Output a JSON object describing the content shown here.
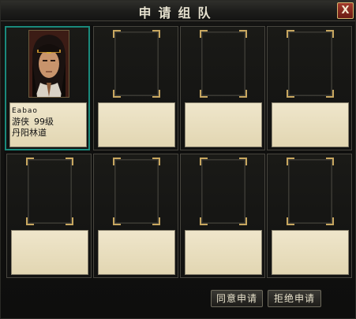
{
  "window": {
    "title": "申请组队",
    "close_label": "X"
  },
  "slots": [
    {
      "occupied": true,
      "name": "Eabao",
      "class": "游侠",
      "level": "99级",
      "location": "丹阳林道"
    },
    {
      "occupied": false
    },
    {
      "occupied": false
    },
    {
      "occupied": false
    },
    {
      "occupied": false
    },
    {
      "occupied": false
    },
    {
      "occupied": false
    },
    {
      "occupied": false
    }
  ],
  "buttons": {
    "accept": "同意申请",
    "reject": "拒绝申请"
  },
  "colors": {
    "selected_border": "#1a8a7c",
    "corner_gold": "#c8a760",
    "panel_bg": "#e8dec0"
  }
}
